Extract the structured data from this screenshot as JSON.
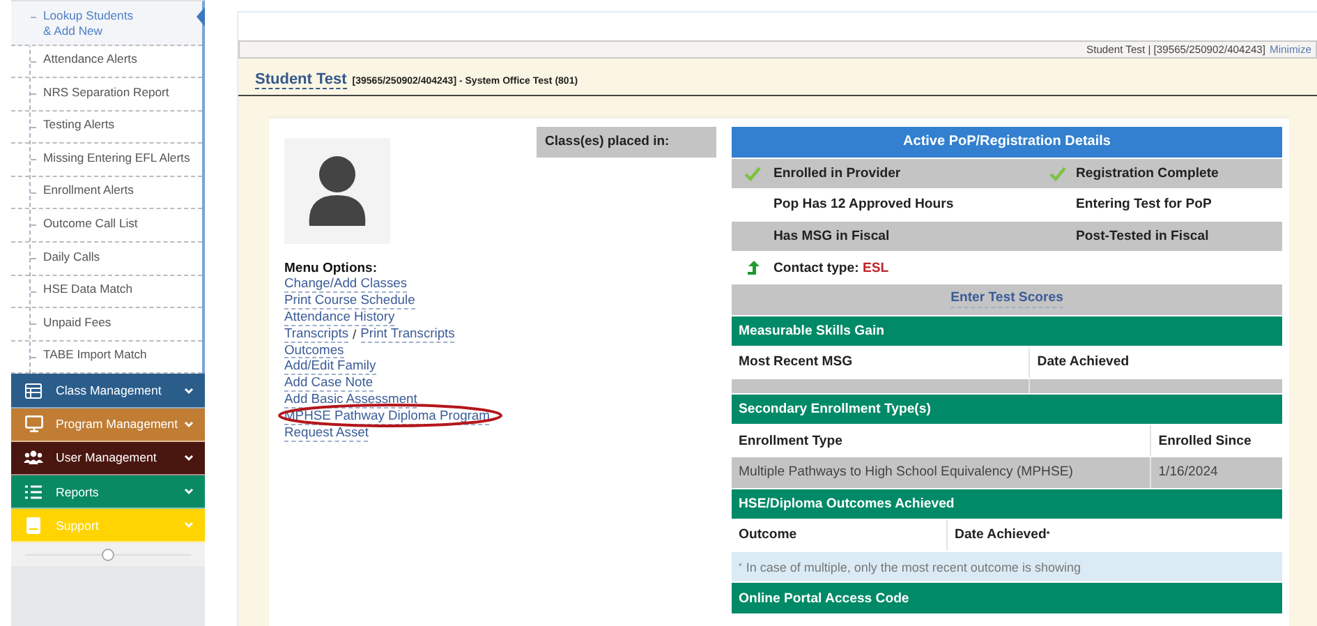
{
  "sidebar": {
    "items": [
      {
        "label": "Lookup Students\n& Add New",
        "selected": true
      },
      {
        "label": "Attendance Alerts",
        "selected": false
      },
      {
        "label": "NRS Separation Report",
        "selected": false
      },
      {
        "label": "Testing Alerts",
        "selected": false
      },
      {
        "label": "Missing Entering EFL Alerts",
        "selected": false
      },
      {
        "label": "Enrollment Alerts",
        "selected": false
      },
      {
        "label": "Outcome Call List",
        "selected": false
      },
      {
        "label": "Daily Calls",
        "selected": false
      },
      {
        "label": "HSE Data Match",
        "selected": false
      },
      {
        "label": "Unpaid Fees",
        "selected": false
      },
      {
        "label": "TABE Import Match",
        "selected": false
      }
    ],
    "sections": [
      {
        "label": "Class Management",
        "color": "#2b5d8b"
      },
      {
        "label": "Program Management",
        "color": "#c07d33"
      },
      {
        "label": "User Management",
        "color": "#4a1610"
      },
      {
        "label": "Reports",
        "color": "#0a8a63"
      },
      {
        "label": "Support",
        "color": "#ffd400"
      }
    ]
  },
  "top_bar": {
    "text": "Student Test | [39565/250902/404243]",
    "link": "Minimize"
  },
  "student_header": {
    "name": "Student Test",
    "details": "[39565/250902/404243] - System Office Test (801)"
  },
  "menu_options": {
    "title": "Menu Options:",
    "items": [
      {
        "kind": "link",
        "label": "Change/Add Classes",
        "highlighted": false
      },
      {
        "kind": "link",
        "label": "Print Course Schedule",
        "highlighted": false
      },
      {
        "kind": "link",
        "label": "Attendance History",
        "highlighted": false
      },
      {
        "kind": "pair",
        "labels": [
          "Transcripts",
          "Print Transcripts"
        ],
        "separator": "/",
        "highlighted": false
      },
      {
        "kind": "link",
        "label": "Outcomes",
        "highlighted": false
      },
      {
        "kind": "link",
        "label": "Add/Edit Family",
        "highlighted": false
      },
      {
        "kind": "link",
        "label": "Add Case Note",
        "highlighted": false
      },
      {
        "kind": "link",
        "label": "Add Basic Assessment",
        "highlighted": false
      },
      {
        "kind": "link",
        "label": "MPHSE Pathway Diploma Program",
        "highlighted": true
      },
      {
        "kind": "link",
        "label": "Request Asset",
        "highlighted": false
      }
    ]
  },
  "classes_box": {
    "title": "Class(es) placed in:"
  },
  "details": {
    "title": "Active PoP/Registration Details",
    "status_items": [
      {
        "label": "Enrolled in Provider",
        "checked": true
      },
      {
        "label": "Registration Complete",
        "checked": true
      },
      {
        "label": "Pop Has 12 Approved Hours",
        "checked": false
      },
      {
        "label": "Entering Test for PoP",
        "checked": false
      },
      {
        "label": "Has MSG in Fiscal",
        "checked": false
      },
      {
        "label": "Post-Tested in Fiscal",
        "checked": false
      }
    ],
    "contact": {
      "label": "Contact type:",
      "value": "ESL"
    },
    "enter_scores_link": "Enter Test Scores",
    "sections": [
      {
        "title": "Measurable Skills Gain",
        "columns": [
          "Most Recent MSG",
          "Date Achieved"
        ],
        "rows": [
          [
            "",
            ""
          ]
        ]
      },
      {
        "title": "Secondary Enrollment Type(s)",
        "columns": [
          "Enrollment Type",
          "Enrolled Since"
        ],
        "rows": [
          [
            "Multiple Pathways to High School Equivalency (MPHSE)",
            "1/16/2024"
          ]
        ]
      },
      {
        "title": "HSE/Diploma Outcomes Achieved",
        "columns": [
          "Outcome",
          "Date Achieved$^{*}$"
        ],
        "note": "$^{*}$ In case of multiple, only the most recent outcome is showing"
      },
      {
        "title": "Online Portal Access Code"
      }
    ]
  }
}
